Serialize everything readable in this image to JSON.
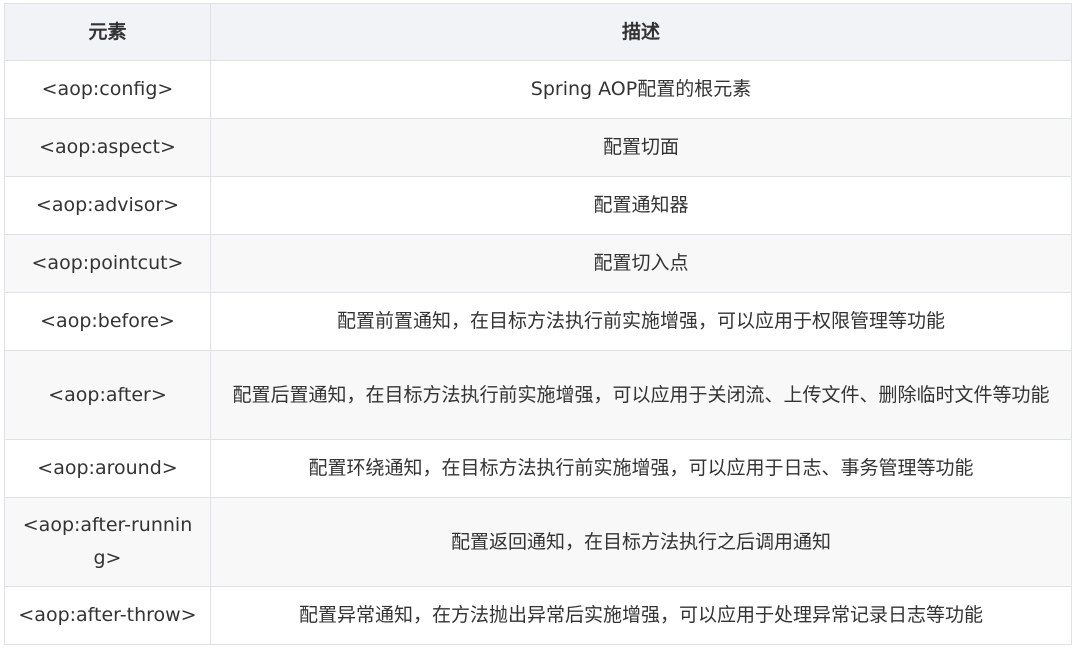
{
  "table": {
    "headers": [
      "元素",
      "描述"
    ],
    "rows": [
      {
        "element": "<aop:config>",
        "description": "Spring AOP配置的根元素"
      },
      {
        "element": "<aop:aspect>",
        "description": "配置切面"
      },
      {
        "element": "<aop:advisor>",
        "description": "配置通知器"
      },
      {
        "element": "<aop:pointcut>",
        "description": "配置切入点"
      },
      {
        "element": "<aop:before>",
        "description": "配置前置通知，在目标方法执行前实施增强，可以应用于权限管理等功能"
      },
      {
        "element": "<aop:after>",
        "description": "配置后置通知，在目标方法执行前实施增强，可以应用于关闭流、上传文件、删除临时文件等功能"
      },
      {
        "element": "<aop:around>",
        "description": "配置环绕通知，在目标方法执行前实施增强，可以应用于日志、事务管理等功能"
      },
      {
        "element": "<aop:after-running>",
        "description": "配置返回通知，在目标方法执行之后调用通知"
      },
      {
        "element": "<aop:after-throw>",
        "description": "配置异常通知，在方法抛出异常后实施增强，可以应用于处理异常记录日志等功能"
      }
    ]
  }
}
